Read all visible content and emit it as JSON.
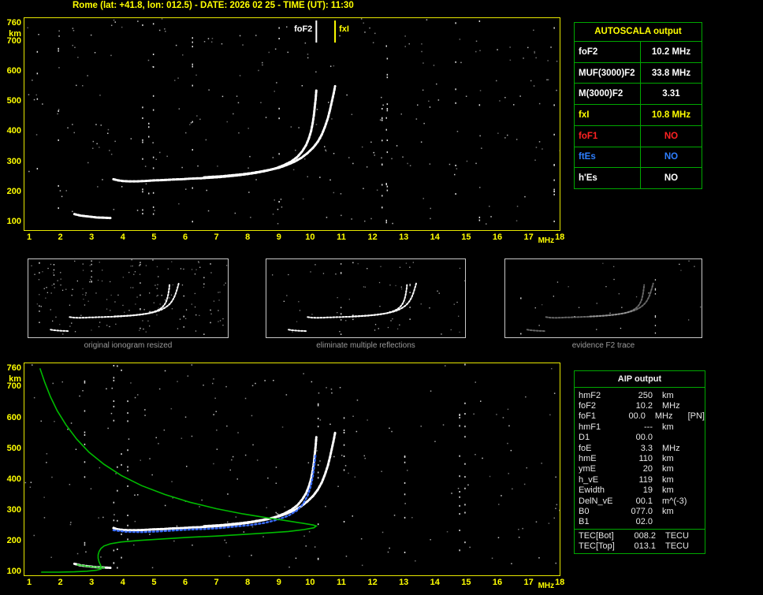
{
  "title": "Rome (lat: +41.8, lon: 012.5) - DATE: 2026 02 25 - TIME (UT): 11:30",
  "colors": {
    "accent_yellow": "#ffff00",
    "table_border_green": "#00a800",
    "status_red": "#ff2222",
    "status_blue": "#2e7fff",
    "trace_white": "#ffffff",
    "profile_green": "#00bb00",
    "fitted_blue": "#3b6eff",
    "caption_gray": "#9a9a9a"
  },
  "autoscala_table": {
    "title": "AUTOSCALA output",
    "rows": [
      {
        "label": "foF2",
        "value": "10.2 MHz",
        "color": "white"
      },
      {
        "label": "MUF(3000)F2",
        "value": "33.8 MHz",
        "color": "white"
      },
      {
        "label": "M(3000)F2",
        "value": "3.31",
        "color": "white"
      },
      {
        "label": "fxI",
        "value": "10.8 MHz",
        "color": "yellow"
      },
      {
        "label": "foF1",
        "value": "NO",
        "color": "red"
      },
      {
        "label": "ftEs",
        "value": "NO",
        "color": "blue"
      },
      {
        "label": "h'Es",
        "value": "NO",
        "color": "white"
      }
    ]
  },
  "aip_table": {
    "title": "AIP output",
    "rows": [
      {
        "name": "hmF2",
        "value": "250",
        "unit": "km",
        "note": ""
      },
      {
        "name": "foF2",
        "value": "10.2",
        "unit": "MHz",
        "note": ""
      },
      {
        "name": "foF1",
        "value": "00.0",
        "unit": "MHz",
        "note": "[PN]"
      },
      {
        "name": "hmF1",
        "value": "---",
        "unit": "km",
        "note": ""
      },
      {
        "name": "D1",
        "value": "00.0",
        "unit": "",
        "note": ""
      },
      {
        "name": "foE",
        "value": "3.3",
        "unit": "MHz",
        "note": ""
      },
      {
        "name": "hmE",
        "value": "110",
        "unit": "km",
        "note": ""
      },
      {
        "name": "ymE",
        "value": "20",
        "unit": "km",
        "note": ""
      },
      {
        "name": "h_vE",
        "value": "119",
        "unit": "km",
        "note": ""
      },
      {
        "name": "Ewidth",
        "value": "19",
        "unit": "km",
        "note": ""
      },
      {
        "name": "DelN_vE",
        "value": "00.1",
        "unit": "m^(-3)",
        "note": ""
      },
      {
        "name": "B0",
        "value": "077.0",
        "unit": "km",
        "note": ""
      },
      {
        "name": "B1",
        "value": "02.0",
        "unit": "",
        "note": ""
      }
    ],
    "tec_rows": [
      {
        "name": "TEC[Bot]",
        "value": "008.2",
        "unit": "TECU"
      },
      {
        "name": "TEC[Top]",
        "value": "013.1",
        "unit": "TECU"
      }
    ]
  },
  "thumbnails": [
    {
      "caption": "original ionogram resized"
    },
    {
      "caption": "eliminate multiple reflections"
    },
    {
      "caption": "evidence F2 trace"
    }
  ],
  "axes": {
    "y_unit": "km",
    "y_ticks": [
      760,
      700,
      600,
      500,
      400,
      300,
      200,
      100
    ],
    "x_unit": "MHz",
    "x_ticks": [
      1,
      2,
      3,
      4,
      5,
      6,
      7,
      8,
      9,
      10,
      11,
      12,
      13,
      14,
      15,
      16,
      17,
      18
    ]
  },
  "chart_data": [
    {
      "id": "top_ionogram",
      "type": "scatter",
      "title": "scaled ionogram (virtual height vs frequency)",
      "xlabel": "MHz",
      "ylabel": "km",
      "xlim": [
        1,
        18
      ],
      "ylim": [
        100,
        760
      ],
      "grid": false,
      "annotations": [
        {
          "label": "foF2",
          "x_mhz": 10.2,
          "color": "#ffffff"
        },
        {
          "label": "fxI",
          "x_mhz": 10.8,
          "color": "#ffff00"
        }
      ],
      "series": [
        {
          "name": "O-trace",
          "color": "#ffffff",
          "points": [
            [
              3.7,
              243
            ],
            [
              3.85,
              239
            ],
            [
              4,
              237
            ],
            [
              4.2,
              236
            ],
            [
              4.45,
              236
            ],
            [
              4.7,
              237
            ],
            [
              5,
              239
            ],
            [
              5.3,
              240
            ],
            [
              5.6,
              242
            ],
            [
              5.9,
              243
            ],
            [
              6.2,
              245
            ],
            [
              6.5,
              246
            ],
            [
              6.8,
              248
            ],
            [
              7.1,
              250
            ],
            [
              7.4,
              253
            ],
            [
              7.7,
              256
            ],
            [
              8,
              260
            ],
            [
              8.3,
              265
            ],
            [
              8.6,
              271
            ],
            [
              8.9,
              279
            ],
            [
              9.15,
              289
            ],
            [
              9.4,
              302
            ],
            [
              9.6,
              318
            ],
            [
              9.75,
              336
            ],
            [
              9.87,
              356
            ],
            [
              9.96,
              378
            ],
            [
              10.03,
              402
            ],
            [
              10.08,
              428
            ],
            [
              10.12,
              455
            ],
            [
              10.15,
              482
            ],
            [
              10.18,
              510
            ],
            [
              10.2,
              538
            ]
          ]
        },
        {
          "name": "X-trace",
          "color": "#ffffff",
          "points": [
            [
              6.6,
              249
            ],
            [
              6.9,
              251
            ],
            [
              7.2,
              253
            ],
            [
              7.5,
              256
            ],
            [
              7.8,
              259
            ],
            [
              8.1,
              263
            ],
            [
              8.4,
              268
            ],
            [
              8.7,
              274
            ],
            [
              9,
              281
            ],
            [
              9.25,
              290
            ],
            [
              9.5,
              301
            ],
            [
              9.72,
              314
            ],
            [
              9.92,
              330
            ],
            [
              10.1,
              348
            ],
            [
              10.25,
              368
            ],
            [
              10.38,
              392
            ],
            [
              10.48,
              418
            ],
            [
              10.57,
              446
            ],
            [
              10.64,
              474
            ],
            [
              10.7,
              502
            ],
            [
              10.76,
              530
            ],
            [
              10.8,
              552
            ]
          ]
        },
        {
          "name": "Es-trace",
          "color": "#ffffff",
          "points": [
            [
              2.45,
              127
            ],
            [
              2.65,
              122
            ],
            [
              2.9,
              119
            ],
            [
              3.15,
              116
            ],
            [
              3.4,
              115
            ],
            [
              3.6,
              114
            ]
          ]
        }
      ]
    },
    {
      "id": "bottom_ionogram_with_profile",
      "type": "scatter",
      "title": "ionogram with restored electron density profile",
      "xlabel": "MHz",
      "ylabel": "km",
      "xlim": [
        1,
        18
      ],
      "ylim": [
        100,
        760
      ],
      "grid": false,
      "series": [
        {
          "name": "O-trace",
          "color": "#ffffff",
          "points": [
            [
              3.7,
              243
            ],
            [
              3.85,
              239
            ],
            [
              4,
              237
            ],
            [
              4.2,
              236
            ],
            [
              4.45,
              236
            ],
            [
              4.7,
              237
            ],
            [
              5,
              239
            ],
            [
              5.3,
              240
            ],
            [
              5.6,
              242
            ],
            [
              5.9,
              243
            ],
            [
              6.2,
              245
            ],
            [
              6.5,
              246
            ],
            [
              6.8,
              248
            ],
            [
              7.1,
              250
            ],
            [
              7.4,
              253
            ],
            [
              7.7,
              256
            ],
            [
              8,
              260
            ],
            [
              8.3,
              265
            ],
            [
              8.6,
              271
            ],
            [
              8.9,
              279
            ],
            [
              9.15,
              289
            ],
            [
              9.4,
              302
            ],
            [
              9.6,
              318
            ],
            [
              9.75,
              336
            ],
            [
              9.87,
              356
            ],
            [
              9.96,
              378
            ],
            [
              10.03,
              402
            ],
            [
              10.08,
              428
            ],
            [
              10.12,
              455
            ],
            [
              10.15,
              482
            ],
            [
              10.18,
              510
            ],
            [
              10.2,
              538
            ]
          ]
        },
        {
          "name": "X-trace",
          "color": "#ffffff",
          "points": [
            [
              6.6,
              249
            ],
            [
              6.9,
              251
            ],
            [
              7.2,
              253
            ],
            [
              7.5,
              256
            ],
            [
              7.8,
              259
            ],
            [
              8.1,
              263
            ],
            [
              8.4,
              268
            ],
            [
              8.7,
              274
            ],
            [
              9,
              281
            ],
            [
              9.25,
              290
            ],
            [
              9.5,
              301
            ],
            [
              9.72,
              314
            ],
            [
              9.92,
              330
            ],
            [
              10.1,
              348
            ],
            [
              10.25,
              368
            ],
            [
              10.38,
              392
            ],
            [
              10.48,
              418
            ],
            [
              10.57,
              446
            ],
            [
              10.64,
              474
            ],
            [
              10.7,
              502
            ],
            [
              10.76,
              530
            ],
            [
              10.8,
              552
            ]
          ]
        },
        {
          "name": "Es-trace",
          "color": "#ffffff",
          "points": [
            [
              2.45,
              127
            ],
            [
              2.65,
              122
            ],
            [
              2.9,
              119
            ],
            [
              3.15,
              116
            ],
            [
              3.4,
              115
            ],
            [
              3.6,
              114
            ]
          ]
        },
        {
          "name": "autoscala-fitted-trace",
          "color": "#3b6eff",
          "points": [
            [
              3.7,
              236
            ],
            [
              4.1,
              231
            ],
            [
              4.6,
              230
            ],
            [
              5.1,
              232
            ],
            [
              5.6,
              235
            ],
            [
              6.1,
              238
            ],
            [
              6.6,
              240
            ],
            [
              7.1,
              243
            ],
            [
              7.6,
              248
            ],
            [
              8.1,
              253
            ],
            [
              8.55,
              260
            ],
            [
              8.95,
              270
            ],
            [
              9.3,
              283
            ],
            [
              9.58,
              300
            ],
            [
              9.78,
              322
            ],
            [
              9.92,
              348
            ],
            [
              10.02,
              378
            ],
            [
              10.09,
              412
            ],
            [
              10.14,
              448
            ],
            [
              10.18,
              485
            ]
          ]
        },
        {
          "name": "electron-density-profile",
          "color": "#00bb00",
          "points": [
            [
              1.35,
              760
            ],
            [
              1.5,
              716
            ],
            [
              1.68,
              670
            ],
            [
              1.9,
              624
            ],
            [
              2.18,
              578
            ],
            [
              2.52,
              532
            ],
            [
              2.92,
              489
            ],
            [
              3.4,
              450
            ],
            [
              3.95,
              414
            ],
            [
              4.6,
              381
            ],
            [
              5.35,
              352
            ],
            [
              6.15,
              327
            ],
            [
              7,
              306
            ],
            [
              7.85,
              289
            ],
            [
              8.65,
              276
            ],
            [
              9.3,
              266
            ],
            [
              9.8,
              258
            ],
            [
              10.1,
              253
            ],
            [
              10.2,
              250
            ],
            [
              10.12,
              244
            ],
            [
              9.8,
              238
            ],
            [
              9.3,
              232
            ],
            [
              8.6,
              227
            ],
            [
              7.8,
              222
            ],
            [
              6.95,
              217
            ],
            [
              6.1,
              213
            ],
            [
              5.3,
              208
            ],
            [
              4.55,
              203
            ],
            [
              3.95,
              198
            ],
            [
              3.6,
              192
            ],
            [
              3.4,
              185
            ],
            [
              3.3,
              177
            ],
            [
              3.24,
              167
            ],
            [
              3.21,
              156
            ],
            [
              3.21,
              145
            ],
            [
              3.24,
              133
            ],
            [
              3.29,
              122
            ],
            [
              3.31,
              113
            ],
            [
              3.3,
              110
            ],
            [
              3.15,
              106
            ],
            [
              2.85,
              103
            ],
            [
              2.45,
              101
            ],
            [
              1.95,
              100
            ],
            [
              1.4,
              100
            ]
          ]
        },
        {
          "name": "Es-overlay",
          "color": "#2ecc2e",
          "points": [
            [
              2.55,
              124
            ],
            [
              2.85,
              119
            ],
            [
              3.15,
              116
            ],
            [
              3.45,
              114
            ]
          ]
        }
      ]
    }
  ]
}
